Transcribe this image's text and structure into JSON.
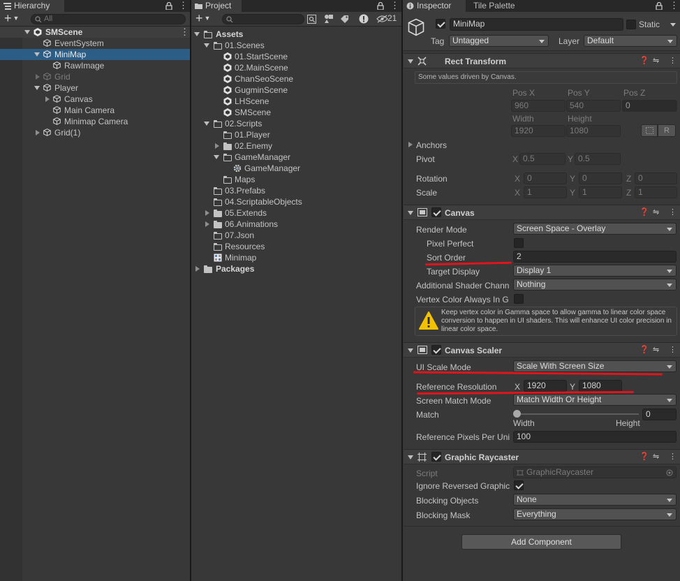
{
  "hierarchy": {
    "tab_label": "Hierarchy",
    "search_placeholder": "All",
    "add_label": "+",
    "rows": [
      {
        "label": "SMScene",
        "type": "scene"
      },
      {
        "label": "EventSystem",
        "type": "obj"
      },
      {
        "label": "MiniMap",
        "type": "obj",
        "selected": true
      },
      {
        "label": "RawImage",
        "type": "obj"
      },
      {
        "label": "Grid",
        "type": "obj",
        "disabled": true
      },
      {
        "label": "Player",
        "type": "obj"
      },
      {
        "label": "Canvas",
        "type": "obj"
      },
      {
        "label": "Main Camera",
        "type": "obj"
      },
      {
        "label": "Minimap Camera",
        "type": "obj"
      },
      {
        "label": "Grid(1)",
        "type": "obj"
      }
    ]
  },
  "project": {
    "tab_label": "Project",
    "hidden_count": "21",
    "rows": [
      {
        "label": "Assets",
        "bold": true
      },
      {
        "label": "01.Scenes"
      },
      {
        "label": "01.StartScene"
      },
      {
        "label": "02.MainScene"
      },
      {
        "label": "ChanSeoScene"
      },
      {
        "label": "GugminScene"
      },
      {
        "label": "LHScene"
      },
      {
        "label": "SMScene"
      },
      {
        "label": "02.Scripts"
      },
      {
        "label": "01.Player"
      },
      {
        "label": "02.Enemy"
      },
      {
        "label": "GameManager"
      },
      {
        "label": "GameManager"
      },
      {
        "label": "Maps"
      },
      {
        "label": "03.Prefabs"
      },
      {
        "label": "04.ScriptableObjects"
      },
      {
        "label": "05.Extends"
      },
      {
        "label": "06.Animations"
      },
      {
        "label": "07.Json"
      },
      {
        "label": "Resources"
      },
      {
        "label": "Minimap"
      },
      {
        "label": "Packages",
        "bold": true
      }
    ]
  },
  "inspector": {
    "tab_label": "Inspector",
    "tab2_label": "Tile Palette",
    "object_name": "MiniMap",
    "static_label": "Static",
    "tag_label": "Tag",
    "tag_value": "Untagged",
    "layer_label": "Layer",
    "layer_value": "Default",
    "rect_transform": {
      "title": "Rect Transform",
      "note": "Some values driven by Canvas.",
      "posx_label": "Pos X",
      "posy_label": "Pos Y",
      "posz_label": "Pos Z",
      "posx": "960",
      "posy": "540",
      "posz": "0",
      "width_label": "Width",
      "height_label": "Height",
      "width": "1920",
      "height": "1080",
      "r_button": "R",
      "anchors_label": "Anchors",
      "pivot_label": "Pivot",
      "pivot_x": "0.5",
      "pivot_y": "0.5",
      "rotation_label": "Rotation",
      "rot_x": "0",
      "rot_y": "0",
      "rot_z": "0",
      "scale_label": "Scale",
      "scale_x": "1",
      "scale_y": "1",
      "scale_z": "1",
      "x": "X",
      "y": "Y",
      "z": "Z"
    },
    "canvas": {
      "title": "Canvas",
      "render_mode_label": "Render Mode",
      "render_mode": "Screen Space - Overlay",
      "pixel_perfect_label": "Pixel Perfect",
      "sort_order_label": "Sort Order",
      "sort_order": "2",
      "target_display_label": "Target Display",
      "target_display": "Display 1",
      "shader_channels_label": "Additional Shader Chann",
      "shader_channels": "Nothing",
      "vertex_color_label": "Vertex Color Always In G",
      "warning": "Keep vertex color in Gamma space to allow gamma to linear color space conversion to happen in UI shaders. This will enhance UI color precision in linear color space."
    },
    "canvas_scaler": {
      "title": "Canvas Scaler",
      "ui_scale_mode_label": "UI Scale Mode",
      "ui_scale_mode": "Scale With Screen Size",
      "ref_res_label": "Reference Resolution",
      "ref_x": "1920",
      "ref_y": "1080",
      "match_mode_label": "Screen Match Mode",
      "match_mode": "Match Width Or Height",
      "match_label": "Match",
      "match_value": "0",
      "match_fraction": 0,
      "width_label": "Width",
      "height_label": "Height",
      "ref_ppu_label": "Reference Pixels Per Uni",
      "ref_ppu": "100"
    },
    "graphic_raycaster": {
      "title": "Graphic Raycaster",
      "script_label": "Script",
      "script_value": "GraphicRaycaster",
      "ignore_reversed_label": "Ignore Reversed Graphic",
      "blocking_objects_label": "Blocking Objects",
      "blocking_objects": "None",
      "blocking_mask_label": "Blocking Mask",
      "blocking_mask": "Everything"
    },
    "add_component": "Add Component"
  },
  "colors": {
    "selection": "#2c5d87",
    "annotation": "#e0141c",
    "warning": "#f2c200"
  }
}
